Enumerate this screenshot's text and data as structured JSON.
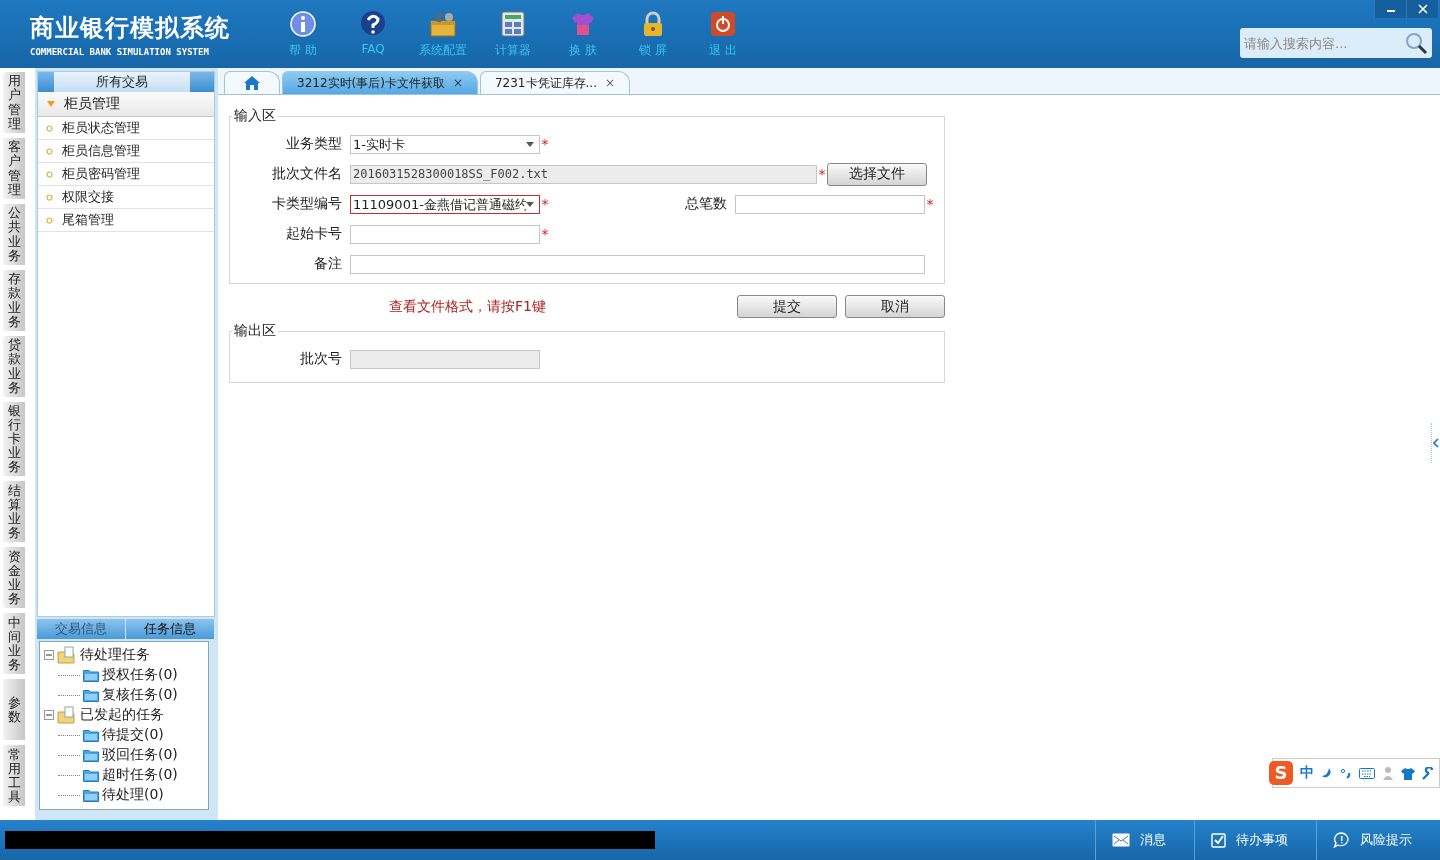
{
  "header": {
    "title": "商业银行模拟系统",
    "subtitle": "COMMERCIAL BANK SIMULATION SYSTEM",
    "toolbar": [
      {
        "kind": "info",
        "label": "帮 助"
      },
      {
        "kind": "faq",
        "label": "FAQ"
      },
      {
        "kind": "config",
        "label": "系统配置"
      },
      {
        "kind": "calculator",
        "label": "计算器"
      },
      {
        "kind": "skin",
        "label": "换 肤"
      },
      {
        "kind": "lock",
        "label": "锁 屏"
      },
      {
        "kind": "exit",
        "label": "退 出"
      }
    ],
    "search": {
      "placeholder": "请输入搜索内容..."
    }
  },
  "side_tabs": [
    "用户管理",
    "客户管理",
    "公共业务",
    "存款业务",
    "贷款业务",
    "银行卡业务",
    "结算业务",
    "资金业务",
    "中间业务",
    "参数",
    "常用工具"
  ],
  "sidebar": {
    "header": "所有交易",
    "group": {
      "label": "柜员管理",
      "expanded": true,
      "items": [
        "柜员状态管理",
        "柜员信息管理",
        "柜员密码管理",
        "权限交接",
        "尾箱管理"
      ]
    }
  },
  "task_panel": {
    "tabs": [
      {
        "label": "交易信息",
        "selected": false
      },
      {
        "label": "任务信息",
        "selected": true
      }
    ],
    "tree": [
      {
        "label": "待处理任务",
        "expanded": true,
        "children": [
          {
            "label": "授权任务(0)"
          },
          {
            "label": "复核任务(0)"
          }
        ]
      },
      {
        "label": "已发起的任务",
        "expanded": true,
        "children": [
          {
            "label": "待提交(0)"
          },
          {
            "label": "驳回任务(0)"
          },
          {
            "label": "超时任务(0)"
          },
          {
            "label": "待处理(0)"
          }
        ]
      }
    ]
  },
  "tabs": [
    {
      "kind": "home",
      "selected": false
    },
    {
      "kind": "page",
      "label": "3212实时(事后)卡文件获取",
      "close": "×",
      "selected": true
    },
    {
      "kind": "page",
      "label": "7231卡凭证库存...",
      "close": "×",
      "selected": false
    }
  ],
  "input_area": {
    "title": "输入区",
    "rows": [
      [
        {
          "kind": "select",
          "label": "业务类型",
          "value": "1-实时卡",
          "required_mark": "*",
          "disabled": false,
          "invalid": false
        }
      ],
      [
        {
          "kind": "input",
          "label": "批次文件名",
          "value": "2016031528300018SS_F002.txt",
          "required_mark": "*",
          "disabled": true,
          "invalid": false
        },
        {
          "kind": "button",
          "label": "选择文件"
        }
      ],
      [
        {
          "kind": "select",
          "label": "卡类型编号",
          "value": "11109001-金燕借记普通磁约",
          "required_mark": "*",
          "disabled": false,
          "invalid": true
        },
        {
          "kind": "input",
          "label": "总笔数",
          "required_mark": "*",
          "disabled": false,
          "invalid": false
        }
      ],
      [
        {
          "kind": "input",
          "label": "起始卡号",
          "required_mark": "*",
          "disabled": false,
          "invalid": false
        }
      ],
      [
        {
          "kind": "input",
          "label": "备注",
          "disabled": false,
          "invalid": false
        }
      ]
    ]
  },
  "hint": "查看文件格式，请按F1键",
  "buttons": [
    "提交",
    "取消"
  ],
  "output_area": {
    "title": "输出区",
    "rows": [
      [
        {
          "kind": "input",
          "label": "批次号",
          "disabled": true,
          "invalid": false
        }
      ]
    ]
  },
  "status_bar": [
    {
      "kind": "mail",
      "label": "消息"
    },
    {
      "kind": "check",
      "label": "待办事项"
    },
    {
      "kind": "chat",
      "label": "风险提示"
    }
  ],
  "ime_bar": {
    "logo": "S",
    "mode": "中"
  }
}
